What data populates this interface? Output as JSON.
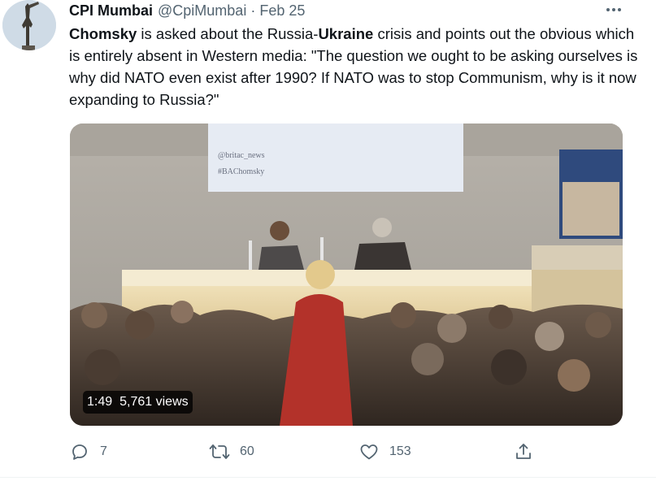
{
  "tweet": {
    "author_name": "CPI Mumbai",
    "author_handle": "@CpiMumbai",
    "separator": "·",
    "date": "Feb 25",
    "text_segments": [
      {
        "text": "Chomsky",
        "bold": true
      },
      {
        "text": " is asked about the Russia-",
        "bold": false
      },
      {
        "text": "Ukraine",
        "bold": true
      },
      {
        "text": " crisis and points out the obvious which is entirely absent in Western media: \"The question we ought to be asking ourselves is why did NATO even exist after 1990? If NATO was to stop Communism, why is it now expanding to Russia?\"",
        "bold": false
      }
    ],
    "video": {
      "duration": "1:49",
      "views": "5,761 views",
      "slide_lines": [
        "@britac_news",
        "#BAChomsky"
      ]
    },
    "actions": {
      "reply_count": "7",
      "retweet_count": "60",
      "like_count": "153"
    },
    "icons": {
      "more": "more-horizontal-icon",
      "reply": "reply-icon",
      "retweet": "retweet-icon",
      "like": "like-icon",
      "share": "share-icon"
    }
  }
}
